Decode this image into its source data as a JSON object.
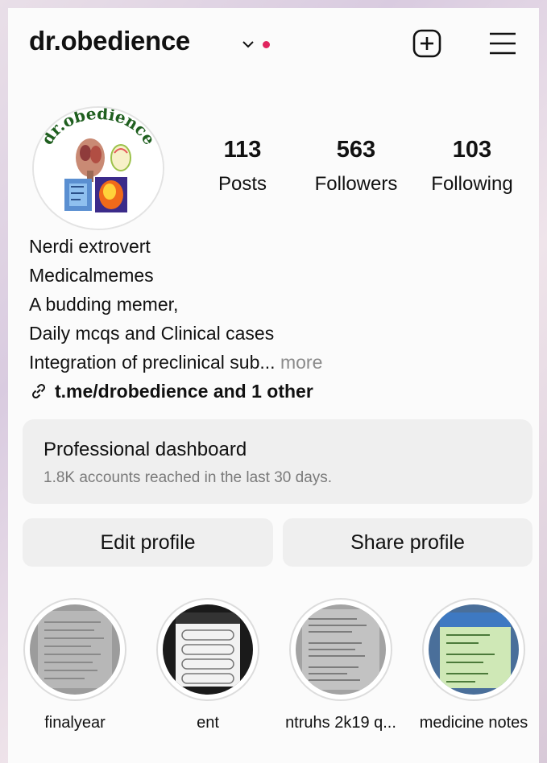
{
  "profile": {
    "username": "dr.obedience",
    "avatar_text": "dr.obedience",
    "stats": [
      {
        "value": "113",
        "label": "Posts"
      },
      {
        "value": "563",
        "label": "Followers"
      },
      {
        "value": "103",
        "label": "Following"
      }
    ],
    "bio": [
      "Nerdi extrovert",
      "Medicalmemes",
      "A budding memer,",
      "Daily mcqs and Clinical cases",
      "Integration of preclinical sub..."
    ],
    "bio_more": " more",
    "link": "t.me/drobedience and 1 other"
  },
  "dashboard": {
    "title": "Professional dashboard",
    "subtitle": "1.8K accounts reached in the last 30 days."
  },
  "actions": {
    "edit_label": "Edit profile",
    "share_label": "Share profile"
  },
  "highlights": [
    {
      "label": "finalyear"
    },
    {
      "label": "ent"
    },
    {
      "label": "ntruhs 2k19 q..."
    },
    {
      "label": "medicine notes"
    }
  ],
  "icons": {
    "chevron": "chevron-down-icon",
    "add": "plus-square-icon",
    "menu": "hamburger-menu-icon",
    "link": "link-icon"
  },
  "colors": {
    "notification_dot": "#e0245e",
    "panel": "#efefef",
    "muted_text": "#8a8a8a"
  }
}
